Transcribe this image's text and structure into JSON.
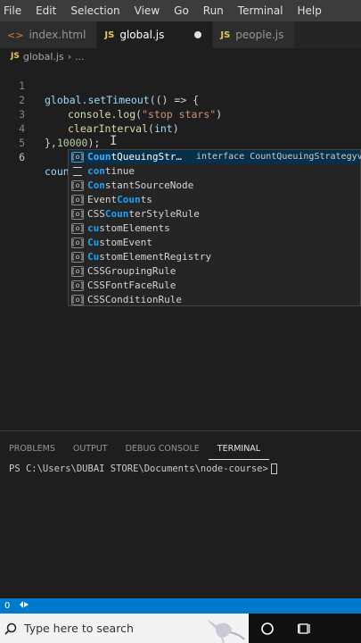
{
  "menu": [
    "File",
    "Edit",
    "Selection",
    "View",
    "Go",
    "Run",
    "Terminal",
    "Help"
  ],
  "tabs": [
    {
      "label": "index.html",
      "icon": "html-icon",
      "active": false
    },
    {
      "label": "global.js",
      "icon": "js-icon",
      "active": true,
      "modified": true
    },
    {
      "label": "people.js",
      "icon": "js-icon",
      "active": false
    }
  ],
  "breadcrumb": {
    "file": "global.js",
    "rest": "..."
  },
  "editor": {
    "line_numbers": [
      "1",
      "2",
      "3",
      "4",
      "5",
      "6"
    ],
    "line1": {
      "fn": "global.setTimeout",
      "args": "(() => {"
    },
    "line2": {
      "fn": "console.log",
      "open": "(",
      "str": "\"stop stars\"",
      "close": ")"
    },
    "line3": {
      "fn": "clearInterval",
      "open": "(",
      "arg": "int",
      "close": ")"
    },
    "line4": {
      "punc": "},",
      "num": "10000",
      "end": ");"
    },
    "line6": {
      "typed": "coun"
    }
  },
  "suggestions": {
    "detail": "interface CountQueuingStrategyvar",
    "items": [
      {
        "pre": "",
        "hl": "Coun",
        "post": "tQueuingStr…",
        "kind": "symbol",
        "selected": true
      },
      {
        "pre": "",
        "hl": "con",
        "post": "tinue",
        "kind": "keyword",
        "selected": false
      },
      {
        "pre": "",
        "hl": "Con",
        "post": "stantSourceNode",
        "kind": "symbol",
        "selected": false
      },
      {
        "pre": "Event",
        "hl": "Coun",
        "post": "ts",
        "kind": "symbol",
        "selected": false
      },
      {
        "pre": "CSS",
        "hl": "Coun",
        "post": "terStyleRule",
        "kind": "symbol",
        "selected": false
      },
      {
        "pre": "",
        "hl": "cu",
        "post": "stomElements",
        "kind": "symbol",
        "selected": false
      },
      {
        "pre": "",
        "hl": "Cu",
        "post": "stomEvent",
        "kind": "symbol",
        "selected": false
      },
      {
        "pre": "",
        "hl": "Cu",
        "post": "stomElementRegistry",
        "kind": "symbol",
        "selected": false
      },
      {
        "pre": "",
        "hl": "CSSGroupingRule",
        "post": "",
        "kind": "symbol",
        "selected": false
      },
      {
        "pre": "",
        "hl": "CSSFontFaceRule",
        "post": "",
        "kind": "symbol",
        "selected": false
      },
      {
        "pre": "",
        "hl": "CSSConditionRule",
        "post": "",
        "kind": "symbol",
        "selected": false
      }
    ]
  },
  "panel": {
    "tabs": [
      "PROBLEMS",
      "OUTPUT",
      "DEBUG CONSOLE",
      "TERMINAL"
    ],
    "active_tab": "TERMINAL",
    "prompt": "PS C:\\Users\\DUBAI STORE\\Documents\\node-course>"
  },
  "statusbar": {
    "problems": "0"
  },
  "taskbar": {
    "search_placeholder": "Type here to search"
  },
  "colors": {
    "accent": "#007acc",
    "editor_bg": "#1e1e1e",
    "selection": "#062f4a"
  }
}
